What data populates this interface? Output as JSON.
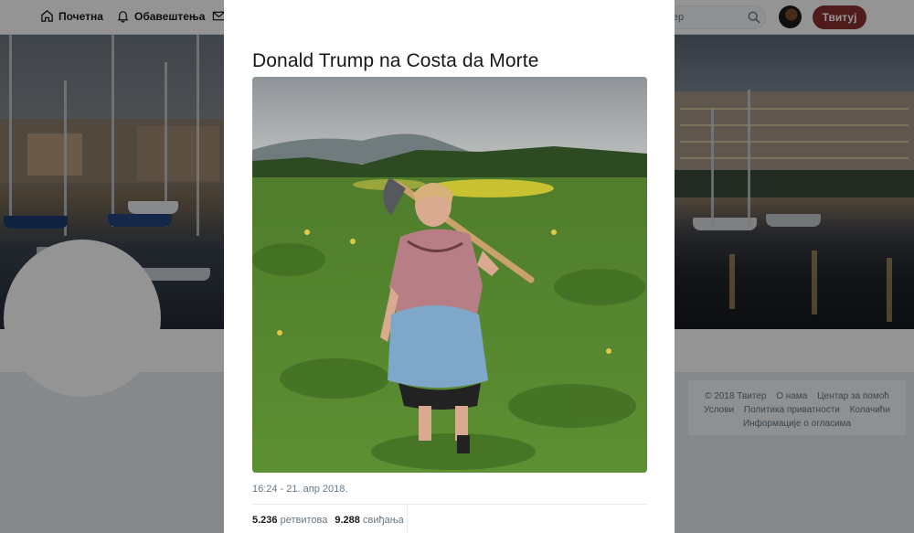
{
  "nav": {
    "home_label": "Почетна",
    "notifications_label": "Обавештења",
    "search_placeholder": "тер",
    "tweet_button": "Твитуј"
  },
  "footer": {
    "copyright": "© 2018 Твитер",
    "about": "О нама",
    "help_center": "Центар за помоћ",
    "terms": "Услови",
    "privacy": "Политика приватности",
    "cookies": "Колачићи",
    "ads_info": "Информације о огласима"
  },
  "tweet": {
    "text": "Donald Trump na Costa da Morte",
    "timestamp": "16:24 - 21. апр 2018.",
    "retweets_count": "5.236",
    "retweets_label": "ретвитова",
    "likes_count": "9.288",
    "likes_label": "свиђања"
  },
  "colors": {
    "tweet_button": "#8b2f2f",
    "overlay": "rgba(0,0,0,0.42)"
  }
}
